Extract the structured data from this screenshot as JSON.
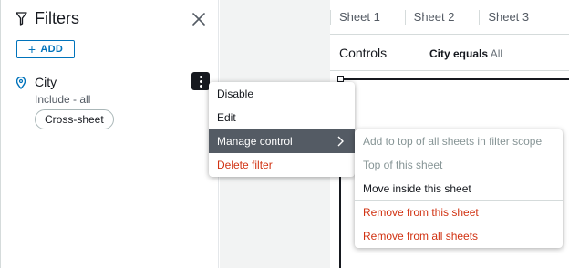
{
  "filters_panel": {
    "title": "Filters",
    "add_label": "ADD",
    "icons": {
      "title_icon": "funnel-icon",
      "close_icon": "close-icon",
      "pin_icon": "location-pin-icon",
      "more_icon": "kebab-menu-icon"
    },
    "filter": {
      "name": "City",
      "description": "Include - all",
      "scope_badge": "Cross-sheet"
    }
  },
  "sheet_tabs": [
    "Sheet 1",
    "Sheet 2",
    "Sheet 3"
  ],
  "controls_bar": {
    "label": "Controls",
    "control_name": "City equals",
    "control_value": "All"
  },
  "context_menu": {
    "items": [
      {
        "label": "Disable",
        "style": "normal"
      },
      {
        "label": "Edit",
        "style": "normal"
      },
      {
        "label": "Manage control",
        "style": "active",
        "has_submenu": true
      },
      {
        "label": "Delete filter",
        "style": "danger"
      }
    ]
  },
  "submenu": {
    "items": [
      {
        "label": "Add to top of all sheets in filter scope",
        "style": "disabled"
      },
      {
        "label": "Top of this sheet",
        "style": "disabled"
      },
      {
        "label": "Move inside this sheet",
        "style": "normal"
      },
      {
        "label": "Remove from this sheet",
        "style": "danger"
      },
      {
        "label": "Remove from all sheets",
        "style": "danger"
      }
    ]
  },
  "colors": {
    "accent_blue": "#0073bb",
    "danger_red": "#d13212",
    "active_menu_bg": "#545b64",
    "disabled_text": "#879596",
    "gutter_gray": "#f2f3f3"
  }
}
